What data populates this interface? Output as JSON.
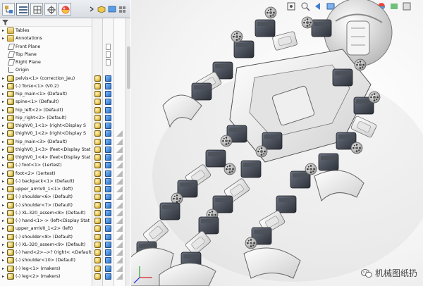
{
  "feature_tree": {
    "items": [
      {
        "label": "Tables",
        "kind": "folder"
      },
      {
        "label": "Annotations",
        "kind": "folder"
      },
      {
        "label": "Front Plane",
        "kind": "plane"
      },
      {
        "label": "Top Plane",
        "kind": "plane"
      },
      {
        "label": "Right Plane",
        "kind": "plane"
      },
      {
        "label": "Origin",
        "kind": "origin"
      },
      {
        "label": "pelvis<1> (correction_jeu)",
        "kind": "part"
      },
      {
        "label": "(-) Torso<1> (V0.2)",
        "kind": "part"
      },
      {
        "label": "hip_main<1> (Default)",
        "kind": "part"
      },
      {
        "label": "spine<1> (Default)",
        "kind": "part"
      },
      {
        "label": "hip_left<2> (Default)",
        "kind": "part"
      },
      {
        "label": "hip_right<2> (Default)",
        "kind": "part"
      },
      {
        "label": "thighV0_1<1> (right<Display S",
        "kind": "part"
      },
      {
        "label": "thighV0_1<2> (right<Display S",
        "kind": "part"
      },
      {
        "label": "hip_main<3> (Default)",
        "kind": "part"
      },
      {
        "label": "thighV0_1<3> (feet<Display Stat",
        "kind": "part"
      },
      {
        "label": "thighV0_1<4> (feet<Display Stat",
        "kind": "part"
      },
      {
        "label": "(-) foot<1> (1ertest)",
        "kind": "part"
      },
      {
        "label": "foot<2> (1ertest)",
        "kind": "part"
      },
      {
        "label": "(-) backpack<1> (Default)",
        "kind": "part"
      },
      {
        "label": "upper_armV0_1<1> (left)",
        "kind": "part"
      },
      {
        "label": "(-) shoulder<6> (Default)",
        "kind": "part"
      },
      {
        "label": "(-) shoulder<7> (Default)",
        "kind": "part"
      },
      {
        "label": "(-) XL-320_assem<8> (Default)",
        "kind": "part"
      },
      {
        "label": "(-) hand<1>-> (left<Display Stat",
        "kind": "part"
      },
      {
        "label": "upper_armV0_1<2> (left)",
        "kind": "part"
      },
      {
        "label": "(-) shoulder<8> (Default)",
        "kind": "part"
      },
      {
        "label": "(-) XL-320_assem<9> (Default)",
        "kind": "part"
      },
      {
        "label": "(-) hand<2>-->? (right< <Default>",
        "kind": "part"
      },
      {
        "label": "(-) shoulder<10> (Default)",
        "kind": "part"
      },
      {
        "label": "(-) leg<1> (makers)",
        "kind": "part"
      },
      {
        "label": "(-) leg<2> (makers)",
        "kind": "part"
      }
    ]
  },
  "watermark": {
    "text": "机械图纸扔"
  },
  "colors": {
    "accent": "#2a6cc2",
    "part": "#e4c95a",
    "servo": "#3b3f4a",
    "bracket": "#f2f2f2"
  }
}
